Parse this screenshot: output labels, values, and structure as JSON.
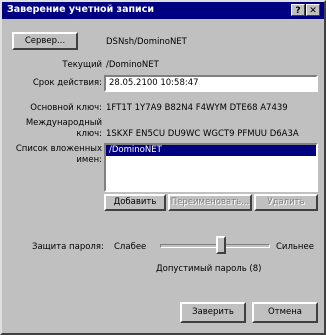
{
  "window": {
    "title": "Заверение учетной записи",
    "help_button": "?",
    "close_button": "✕"
  },
  "server": {
    "button": "Сервер...",
    "value": "DSNsh/DominoNET"
  },
  "current": {
    "label": "Текущий",
    "value": "/DominoNET"
  },
  "expiration": {
    "label": "Срок действия:",
    "value": "28.05.2100 10:58:47"
  },
  "primary_key": {
    "label": "Основной ключ:",
    "value": "1FT1T 1Y7A9 B82N4 F4WYM DTE68 A7439"
  },
  "intl_key": {
    "label_line1": "Международный",
    "label_line2": "ключ:",
    "value": "1SKXF EN5CU DU9WC WGCT9 PFMUU D6A3A"
  },
  "names": {
    "label_line1": "Список вложенных",
    "label_line2": "имен:",
    "items": [
      "/DominoNET"
    ]
  },
  "list_buttons": {
    "add": "Добавить",
    "rename": "Переименовать...",
    "remove": "Удалить"
  },
  "password": {
    "label": "Защита пароля:",
    "weak": "Слабее",
    "strong": "Сильнее",
    "status": "Допустимый пароль (8)",
    "level": 0.55
  },
  "actions": {
    "ok": "Заверить",
    "cancel": "Отмена"
  }
}
